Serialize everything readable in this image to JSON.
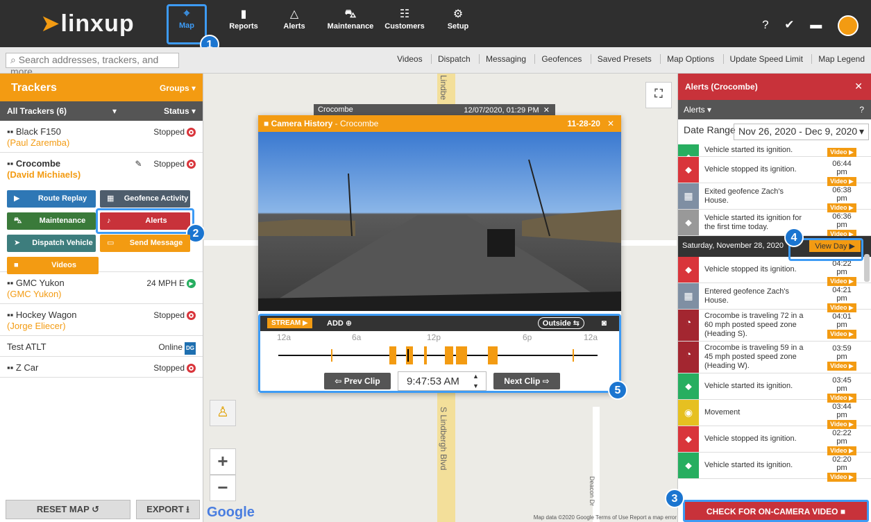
{
  "app": {
    "logo": "linxup",
    "logo_mark": "➤"
  },
  "nav": [
    {
      "label": "Map",
      "icon": "map-pin-icon"
    },
    {
      "label": "Reports",
      "icon": "bar-chart-icon"
    },
    {
      "label": "Alerts",
      "icon": "bell-icon"
    },
    {
      "label": "Maintenance",
      "icon": "car-icon"
    },
    {
      "label": "Customers",
      "icon": "people-icon"
    },
    {
      "label": "Setup",
      "icon": "gear-icon"
    }
  ],
  "search": {
    "placeholder": "Search addresses, trackers, and more"
  },
  "toolbar": [
    "Videos",
    "Dispatch",
    "Messaging",
    "Geofences",
    "Saved Presets",
    "Map Options",
    "Update Speed Limit",
    "Map Legend"
  ],
  "sidebar": {
    "title": "Trackers",
    "groups": "Groups",
    "filter": "All Trackers (6)",
    "status": "Status",
    "trackers": [
      {
        "name": "Black F150",
        "driver": "(Paul Zaremba)",
        "status": "Stopped"
      },
      {
        "name": "Crocombe",
        "driver": "(David Michiaels)",
        "status": "Stopped"
      },
      {
        "name": "GMC Yukon",
        "driver": "(GMC Yukon)",
        "status": "24 MPH E"
      },
      {
        "name": "Hockey Wagon",
        "driver": "(Jorge Eliecer)",
        "status": "Stopped"
      },
      {
        "name": "Test ATLT",
        "driver": "",
        "status": "Online",
        "status_badge": "DG"
      },
      {
        "name": "Z Car",
        "driver": "",
        "status": "Stopped"
      }
    ],
    "actions": [
      "Route Replay",
      "Geofence Activity",
      "Maintenance",
      "Alerts",
      "Dispatch Vehicle",
      "Send Message",
      "Videos"
    ],
    "reset": "RESET MAP",
    "export": "EXPORT"
  },
  "camera": {
    "tab_title": "Crocombe",
    "tab_time": "12/07/2020, 01:29 PM",
    "title": "Camera History",
    "vehicle": "- Crocombe",
    "date": "11-28-20",
    "stream": "STREAM",
    "add": "ADD",
    "view": "Outside",
    "ticks": [
      "12a",
      "6a",
      "12p",
      "6p",
      "12a"
    ],
    "prev": "Prev Clip",
    "next": "Next Clip",
    "time": "9:47:53 AM"
  },
  "map": {
    "google": "Google",
    "footer": "Map data ©2020 Google   Terms of Use   Report a map error",
    "street": "S Lindbergh Blvd",
    "street_top": "Lindbe",
    "street2": "Deacon Dr"
  },
  "alerts": {
    "title": "Alerts (Crocombe)",
    "sub": "Alerts",
    "date_label": "Date Range",
    "date_value": "Nov 26, 2020 - Dec 9, 2020",
    "items_top": [
      {
        "text": "Vehicle started its ignition.",
        "time": "",
        "type": "g"
      },
      {
        "text": "Vehicle stopped its ignition.",
        "time": "06:44 pm",
        "type": "r"
      },
      {
        "text": "Exited geofence Zach's House.",
        "time": "06:38 pm",
        "type": "gb"
      },
      {
        "text": "Vehicle started its ignition for the first time today.",
        "time": "06:36 pm",
        "type": "gr"
      }
    ],
    "day": "Saturday, November 28, 2020",
    "view_day": "View Day",
    "items": [
      {
        "text": "Vehicle stopped its ignition.",
        "time": "04:22 pm",
        "type": "r"
      },
      {
        "text": "Entered geofence Zach's House.",
        "time": "04:21 pm",
        "type": "gb"
      },
      {
        "text": "Crocombe is traveling 72 in a 60 mph posted speed zone (Heading S).",
        "time": "04:01 pm",
        "type": "dr"
      },
      {
        "text": "Crocombe is traveling 59 in a 45 mph posted speed zone (Heading W).",
        "time": "03:59 pm",
        "type": "dr"
      },
      {
        "text": "Vehicle started its ignition.",
        "time": "03:45 pm",
        "type": "g"
      },
      {
        "text": "Movement",
        "time": "03:44 pm",
        "type": "y"
      },
      {
        "text": "Vehicle stopped its ignition.",
        "time": "02:22 pm",
        "type": "r"
      },
      {
        "text": "Vehicle started its ignition.",
        "time": "02:20 pm",
        "type": "g"
      }
    ],
    "video_label": "Video ▶",
    "check": "CHECK FOR ON-CAMERA VIDEO"
  },
  "badges": [
    "1",
    "2",
    "3",
    "4",
    "5"
  ]
}
